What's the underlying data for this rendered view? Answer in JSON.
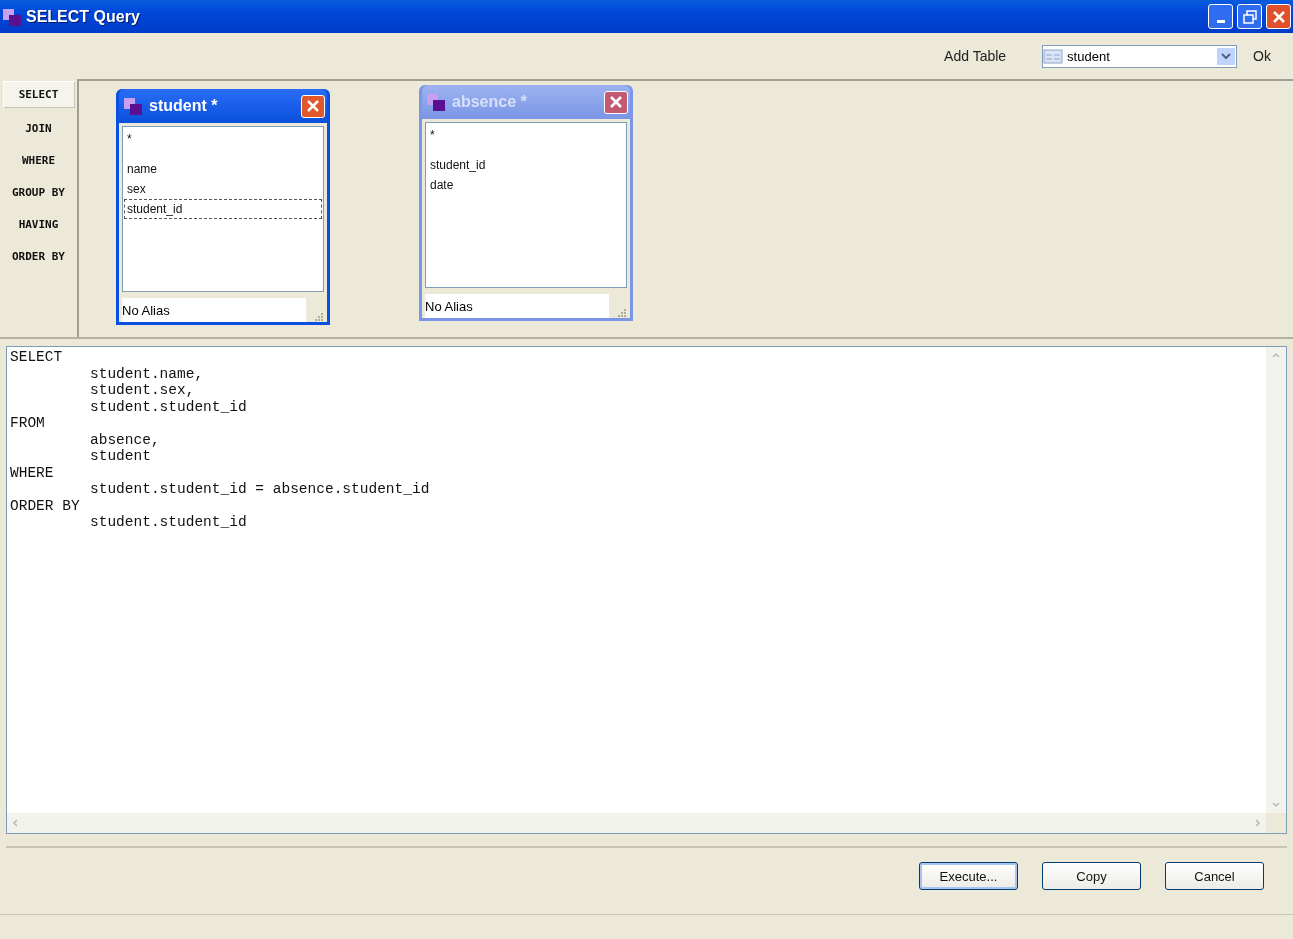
{
  "window": {
    "title": "SELECT Query"
  },
  "toolbar": {
    "add_table_label": "Add Table",
    "table_select": "student",
    "ok": "Ok"
  },
  "clauses": [
    {
      "label": "SELECT",
      "selected": true
    },
    {
      "label": "JOIN",
      "selected": false
    },
    {
      "label": "WHERE",
      "selected": false
    },
    {
      "label": "GROUP BY",
      "selected": false
    },
    {
      "label": "HAVING",
      "selected": false
    },
    {
      "label": "ORDER BY",
      "selected": false
    }
  ],
  "tables": [
    {
      "title": "student *",
      "active": true,
      "alias": "No Alias",
      "columns": [
        {
          "name": "*",
          "selected": false
        },
        {
          "name": "name",
          "selected": false
        },
        {
          "name": "sex",
          "selected": false
        },
        {
          "name": "student_id",
          "selected": true
        }
      ]
    },
    {
      "title": "absence *",
      "active": false,
      "alias": "No Alias",
      "columns": [
        {
          "name": "*",
          "selected": false
        },
        {
          "name": "student_id",
          "selected": false
        },
        {
          "name": "date",
          "selected": false
        }
      ]
    }
  ],
  "sql": [
    {
      "text": "SELECT",
      "indent": false
    },
    {
      "text": "student.name,",
      "indent": true
    },
    {
      "text": "student.sex,",
      "indent": true
    },
    {
      "text": "student.student_id",
      "indent": true
    },
    {
      "text": "FROM",
      "indent": false
    },
    {
      "text": "absence,",
      "indent": true
    },
    {
      "text": "student",
      "indent": true
    },
    {
      "text": "WHERE",
      "indent": false
    },
    {
      "text": "student.student_id = absence.student_id",
      "indent": true
    },
    {
      "text": "ORDER BY",
      "indent": false
    },
    {
      "text": "student.student_id",
      "indent": true
    }
  ],
  "buttons": [
    {
      "label": "Execute...",
      "selected": true
    },
    {
      "label": "Copy",
      "selected": false
    },
    {
      "label": "Cancel",
      "selected": false
    }
  ]
}
